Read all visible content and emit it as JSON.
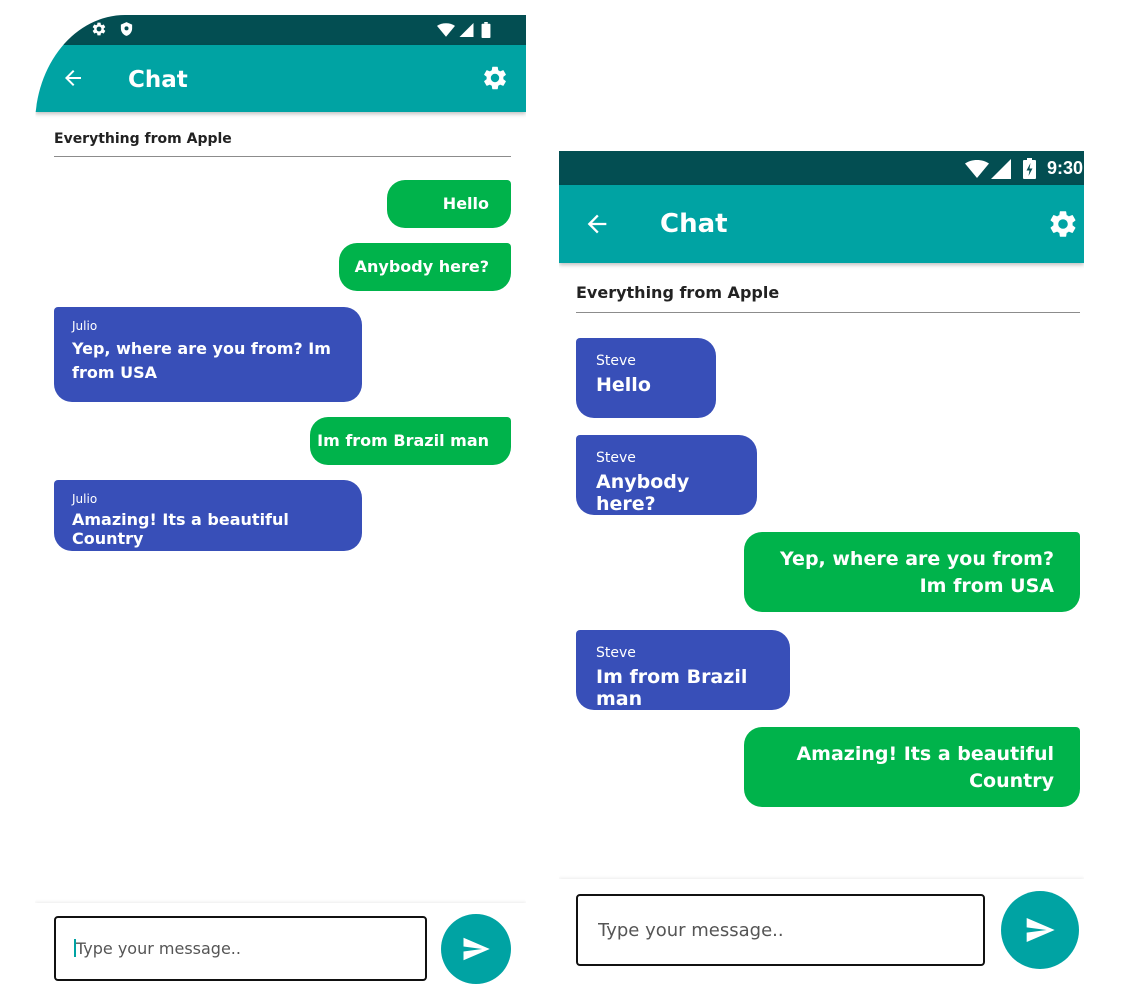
{
  "colors": {
    "status_bar": "#034e52",
    "app_bar": "#00a3a3",
    "sent_bubble": "#00b34b",
    "received_bubble": "#384fb8"
  },
  "left_screen": {
    "app_bar": {
      "title": "Chat",
      "back_icon": "arrow-left-icon",
      "settings_icon": "gear-icon"
    },
    "status_icons": [
      "settings-icon",
      "shield-icon",
      "wifi-icon",
      "signal-icon",
      "battery-icon"
    ],
    "room_title": "Everything from Apple",
    "messages": [
      {
        "type": "sent",
        "text": "Hello"
      },
      {
        "type": "sent",
        "text": "Anybody here?"
      },
      {
        "type": "received",
        "sender": "Julio",
        "text": "Yep, where are you from? Im from USA"
      },
      {
        "type": "sent",
        "text": "Im from Brazil man"
      },
      {
        "type": "received",
        "sender": "Julio",
        "text": "Amazing! Its a beautiful Country"
      }
    ],
    "composer": {
      "placeholder": "Type your message..",
      "send_icon": "send-icon"
    }
  },
  "right_screen": {
    "status_bar": {
      "time": "9:30",
      "icons": [
        "wifi-icon",
        "signal-icon",
        "battery-charging-icon"
      ]
    },
    "app_bar": {
      "title": "Chat",
      "back_icon": "arrow-left-icon",
      "settings_icon": "gear-icon"
    },
    "room_title": "Everything from Apple",
    "messages": [
      {
        "type": "received",
        "sender": "Steve",
        "text": "Hello"
      },
      {
        "type": "received",
        "sender": "Steve",
        "text": "Anybody here?"
      },
      {
        "type": "sent",
        "text": "Yep, where are you from? Im from USA"
      },
      {
        "type": "received",
        "sender": "Steve",
        "text": "Im from Brazil man"
      },
      {
        "type": "sent",
        "text": "Amazing! Its a beautiful Country"
      }
    ],
    "composer": {
      "placeholder": "Type your message..",
      "send_icon": "send-icon"
    }
  }
}
